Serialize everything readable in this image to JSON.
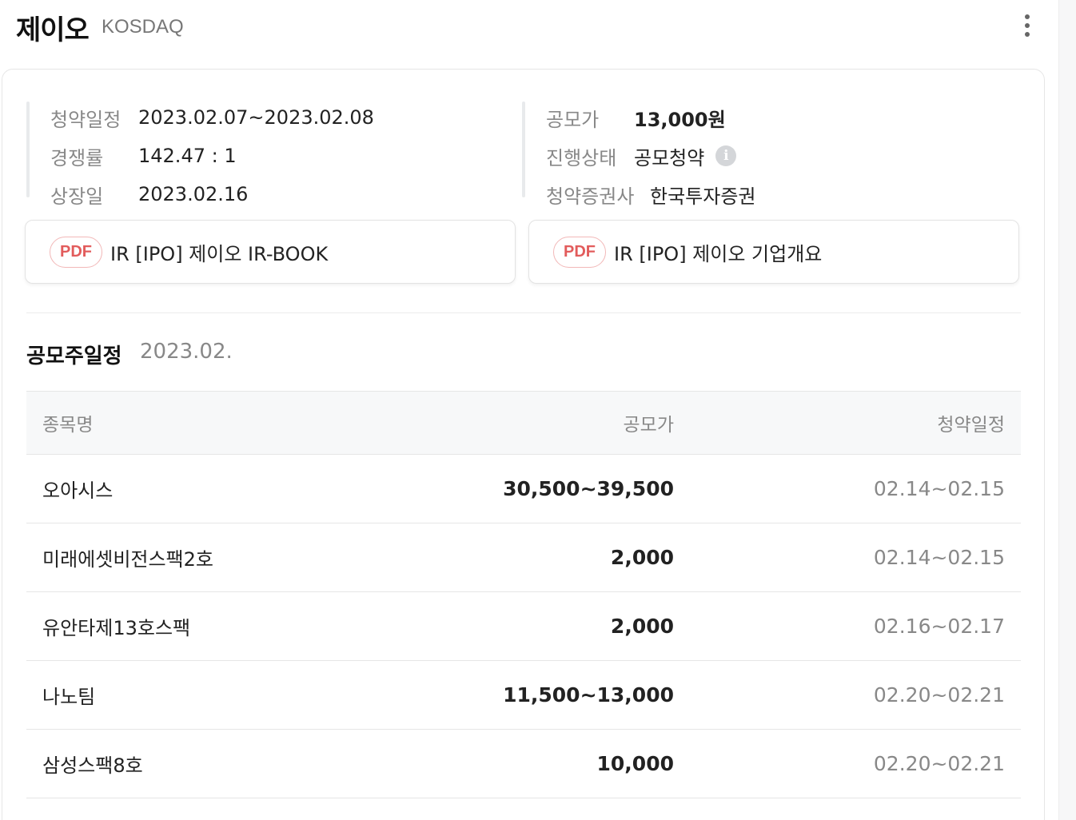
{
  "header": {
    "stock_name": "제이오",
    "market": "KOSDAQ",
    "more_icon": "more-vertical-icon"
  },
  "info": {
    "left": [
      {
        "label": "청약일정",
        "value": "2023.02.07~2023.02.08"
      },
      {
        "label": "경쟁률",
        "value": "142.47 : 1"
      },
      {
        "label": "상장일",
        "value": "2023.02.16"
      }
    ],
    "right": [
      {
        "label": "공모가",
        "value": "13,000원"
      },
      {
        "label": "진행상태",
        "value": "공모청약"
      },
      {
        "label": "청약증권사",
        "value": "한국투자증권"
      }
    ],
    "info_icon": "i"
  },
  "documents": [
    {
      "badge": "PDF",
      "title": "IR [IPO] 제이오 IR-BOOK"
    },
    {
      "badge": "PDF",
      "title": "IR [IPO] 제이오 기업개요"
    }
  ],
  "schedule": {
    "title": "공모주일정",
    "month": "2023.02.",
    "columns": [
      "종목명",
      "공모가",
      "청약일정"
    ],
    "rows": [
      {
        "name": "오아시스",
        "price": "30,500~39,500",
        "dates": "02.14~02.15"
      },
      {
        "name": "미래에셋비전스팩2호",
        "price": "2,000",
        "dates": "02.14~02.15"
      },
      {
        "name": "유안타제13호스팩",
        "price": "2,000",
        "dates": "02.16~02.17"
      },
      {
        "name": "나노팀",
        "price": "11,500~13,000",
        "dates": "02.20~02.21"
      },
      {
        "name": "삼성스팩8호",
        "price": "10,000",
        "dates": "02.20~02.21"
      }
    ]
  },
  "colors": {
    "pdf_accent": "#e25c5c",
    "muted_text": "#888888"
  }
}
